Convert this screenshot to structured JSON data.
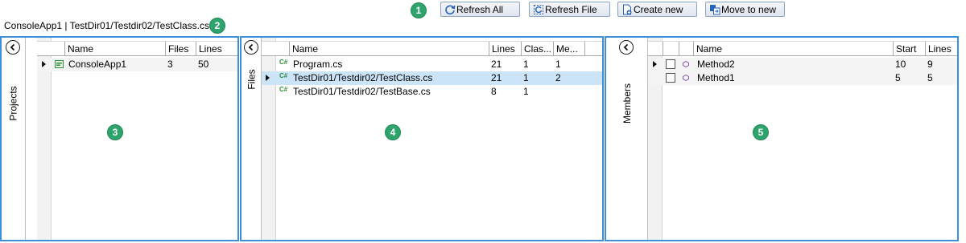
{
  "markers": [
    "1",
    "2",
    "3",
    "4",
    "5"
  ],
  "toolbar": {
    "refresh_all": "Refresh All",
    "refresh_file": "Refresh File",
    "create_new": "Create new",
    "move_to_new": "Move to new"
  },
  "path": "ConsoleApp1 | TestDir01/Testdir02/TestClass.cs",
  "projects": {
    "label": "Projects",
    "columns": [
      "Name",
      "Files",
      "Lines"
    ],
    "rows": [
      {
        "name": "ConsoleApp1",
        "files": "3",
        "lines": "50",
        "icon": "project-icon"
      }
    ]
  },
  "files": {
    "label": "Files",
    "columns": [
      "Name",
      "Lines",
      "Clas...",
      "Me..."
    ],
    "rows": [
      {
        "name": "Program.cs",
        "lines": "21",
        "classes": "1",
        "members": "1",
        "icon": "csharp-file-icon"
      },
      {
        "name": "TestDir01/Testdir02/TestClass.cs",
        "lines": "21",
        "classes": "1",
        "members": "2",
        "icon": "csharp-file-icon"
      },
      {
        "name": "TestDir01/Testdir02/TestBase.cs",
        "lines": "8",
        "classes": "1",
        "members": "",
        "icon": "csharp-file-icon"
      }
    ]
  },
  "members": {
    "label": "Members",
    "columns": [
      "Name",
      "Start",
      "Lines"
    ],
    "rows": [
      {
        "name": "Method2",
        "start": "10",
        "lines": "9",
        "checked": false,
        "icon": "method-icon"
      },
      {
        "name": "Method1",
        "start": "5",
        "lines": "5",
        "checked": false,
        "icon": "method-icon"
      }
    ]
  },
  "colors": {
    "panel_border": "#3d8fd6",
    "marker": "#2ea36b",
    "selected_row": "#cce4f7",
    "button_border": "#8aa3c2"
  }
}
